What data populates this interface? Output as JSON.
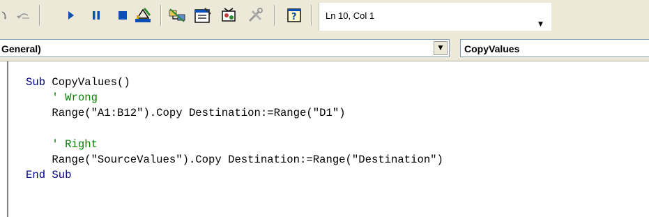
{
  "toolbar": {
    "buttons": [
      {
        "name": "redo-icon",
        "glyph": "⟳"
      },
      {
        "name": "undo-icon",
        "glyph": "↶"
      },
      {
        "name": "run-icon",
        "glyph": "▶"
      },
      {
        "name": "break-icon",
        "glyph": "❚❚"
      },
      {
        "name": "reset-icon",
        "glyph": "■"
      },
      {
        "name": "design-mode-icon",
        "glyph": "📐"
      },
      {
        "name": "project-explorer-icon",
        "glyph": "🗂"
      },
      {
        "name": "properties-window-icon",
        "glyph": "🗒"
      },
      {
        "name": "object-browser-icon",
        "glyph": "🧰"
      },
      {
        "name": "toolbox-icon",
        "glyph": "🛠"
      },
      {
        "name": "help-icon",
        "glyph": "?"
      }
    ],
    "status_text": "Ln 10, Col 1",
    "status_dropdown_glyph": "▼"
  },
  "object_combo": {
    "value": "General)",
    "arrow_glyph": "▼"
  },
  "procedure_combo": {
    "value": "CopyValues"
  },
  "code": {
    "lines": [
      [
        {
          "t": "Sub",
          "c": "kw"
        },
        {
          "t": " CopyValues()",
          "c": ""
        }
      ],
      [
        {
          "t": "    ' Wrong",
          "c": "cm"
        }
      ],
      [
        {
          "t": "    Range(\"A1:B12\").Copy Destination:=Range(\"D1\")",
          "c": ""
        }
      ],
      [
        {
          "t": "",
          "c": ""
        }
      ],
      [
        {
          "t": "    ' Right",
          "c": "cm"
        }
      ],
      [
        {
          "t": "    Range(\"SourceValues\").Copy Destination:=Range(\"Destination\")",
          "c": ""
        }
      ],
      [
        {
          "t": "End Sub",
          "c": "kw"
        }
      ]
    ]
  },
  "colors": {
    "keyword": "#00008b",
    "comment": "#008000",
    "toolbar_bg": "#ece9d8"
  }
}
